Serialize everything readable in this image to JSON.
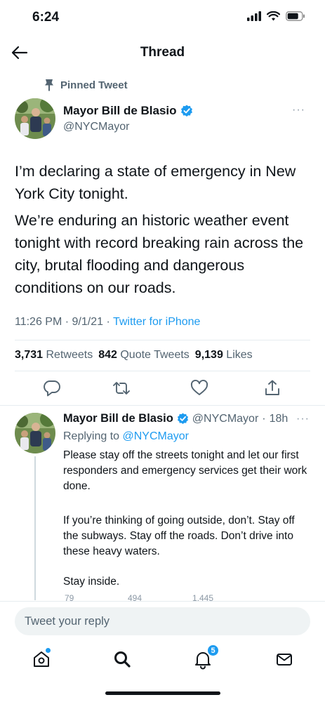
{
  "status_bar": {
    "time": "6:24"
  },
  "nav": {
    "title": "Thread"
  },
  "main_tweet": {
    "pinned_label": "Pinned Tweet",
    "author_name": "Mayor Bill de Blasio",
    "author_handle": "@NYCMayor",
    "more": "···",
    "paragraph1": "I’m declaring a state of emergency in New York City tonight.",
    "paragraph2": "We’re enduring an historic weather event tonight with record breaking rain across the city, brutal flooding and dangerous conditions on our roads.",
    "time": "11:26 PM",
    "date": "9/1/21",
    "source": "Twitter for iPhone",
    "retweets_count": "3,731",
    "retweets_label": "Retweets",
    "quotes_count": "842",
    "quotes_label": "Quote Tweets",
    "likes_count": "9,139",
    "likes_label": "Likes"
  },
  "reply_tweet": {
    "author_name": "Mayor Bill de Blasio",
    "author_handle": "@NYCMayor",
    "age": "18h",
    "more": "···",
    "replying_prefix": "Replying to",
    "replying_to": "@NYCMayor",
    "paragraph1": "Please stay off the streets tonight and let our first responders and emergency services get their work done.",
    "paragraph2": "If you’re thinking of going outside, don’t. Stay off the subways. Stay off the roads. Don’t drive into these heavy waters.",
    "paragraph3": "Stay inside.",
    "reply_count": "79",
    "retweet_count": "494",
    "like_count": "1,445"
  },
  "compose": {
    "placeholder": "Tweet your reply"
  },
  "tab_bar": {
    "notifications_badge": "5"
  },
  "colors": {
    "accent": "#1d9bf0",
    "secondary_text": "#536471",
    "primary_text": "#0f1419"
  }
}
